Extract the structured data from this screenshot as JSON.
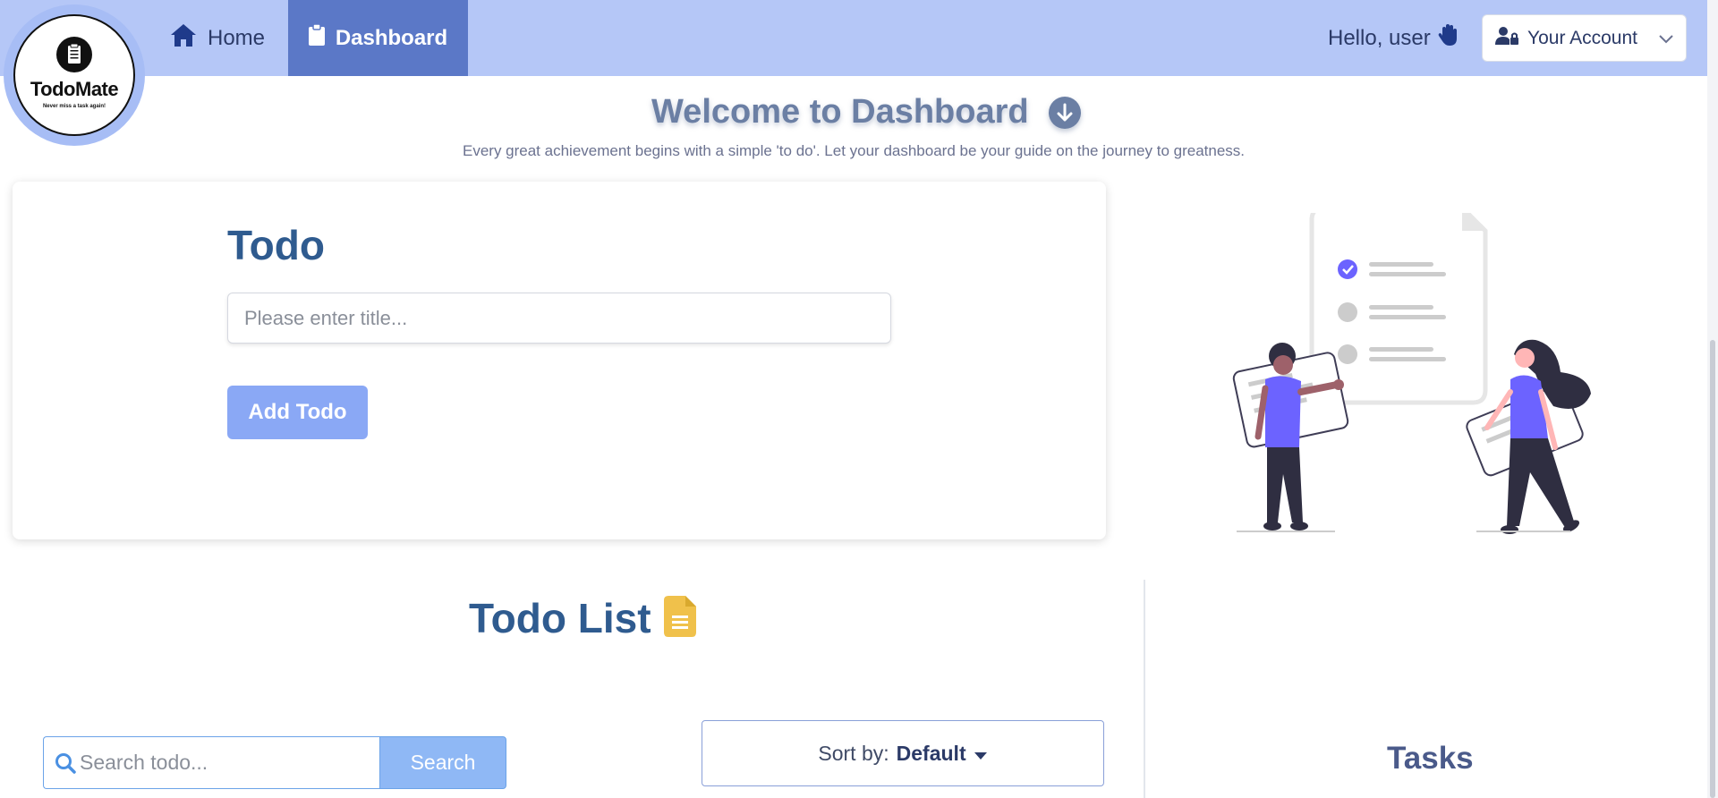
{
  "brand": {
    "name": "TodoMate",
    "tagline": "Never miss a task again!"
  },
  "nav": {
    "home_label": "Home",
    "dashboard_label": "Dashboard",
    "active": "Dashboard"
  },
  "user": {
    "greeting": "Hello, user",
    "account_label": "Your Account"
  },
  "hero": {
    "title": "Welcome to Dashboard",
    "subtitle": "Every great achievement begins with a simple 'to do'. Let your dashboard be your guide on the journey to greatness."
  },
  "todo_form": {
    "heading": "Todo",
    "title_placeholder": "Please enter title...",
    "add_label": "Add Todo"
  },
  "todo_list": {
    "heading": "Todo List",
    "search_placeholder": "Search todo...",
    "search_label": "Search",
    "sort_prefix": "Sort by:",
    "sort_value": "Default"
  },
  "tasks_panel": {
    "heading": "Tasks"
  },
  "icons": [
    "clipboard-icon",
    "home-icon",
    "hand-wave-icon",
    "user-lock-icon",
    "chevron-down-icon",
    "arrow-down-circle-icon",
    "file-text-icon",
    "search-icon",
    "caret-down-icon"
  ],
  "colors": {
    "navbar": "#b5c7f7",
    "nav_active": "#5b78c7",
    "heading": "#2f5b8f",
    "accent": "#6c63ff",
    "add_button": "#8aa8f5",
    "search_button": "#8fb8f5",
    "list_icon": "#f0c14b"
  }
}
